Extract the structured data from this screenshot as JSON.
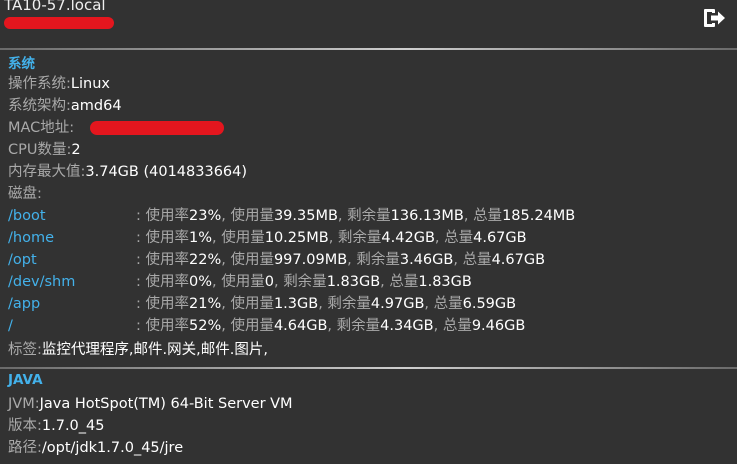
{
  "header": {
    "hostname": "TA10-57.local",
    "logout_icon": "logout-icon"
  },
  "system": {
    "title": "系统",
    "os_label": "操作系统:",
    "os_value": "Linux",
    "arch_label": "系统架构:",
    "arch_value": "amd64",
    "mac_label": "MAC地址:",
    "cpu_label": "CPU数量:",
    "cpu_value": "2",
    "mem_label": "内存最大值:",
    "mem_value": "3.74GB (4014833664)",
    "disk_label": "磁盘:",
    "tags_label": "标签:",
    "tags_value": "监控代理程序,邮件.网关,邮件.图片,"
  },
  "disks": [
    {
      "path": "/boot",
      "usage": "23%",
      "used": "39.35MB",
      "free": "136.13MB",
      "total": "185.24MB"
    },
    {
      "path": "/home",
      "usage": "1%",
      "used": "10.25MB",
      "free": "4.42GB",
      "total": "4.67GB"
    },
    {
      "path": "/opt",
      "usage": "22%",
      "used": "997.09MB",
      "free": "3.46GB",
      "total": "4.67GB"
    },
    {
      "path": "/dev/shm",
      "usage": "0%",
      "used": "0",
      "free": "1.83GB",
      "total": "1.83GB"
    },
    {
      "path": "/app",
      "usage": "21%",
      "used": "1.3GB",
      "free": "4.97GB",
      "total": "6.59GB"
    },
    {
      "path": "/",
      "usage": "52%",
      "used": "4.64GB",
      "free": "4.34GB",
      "total": "9.46GB"
    }
  ],
  "disk_labels": {
    "sep": ": ",
    "usage_label": "使用率",
    "used_label": "使用量",
    "free_label": "剩余量",
    "total_label": "总量",
    "comma": ", "
  },
  "java": {
    "title": "JAVA",
    "jvm_label": "JVM:",
    "jvm_value": "Java HotSpot(TM) 64-Bit Server VM",
    "version_label": "版本:",
    "version_value": "1.7.0_45",
    "path_label": "路径:",
    "path_value": "/opt/jdk1.7.0_45/jre"
  },
  "colors": {
    "background": "#323232",
    "accent": "#43b1ea",
    "label": "#a9a9a9",
    "redaction": "#e4161e"
  }
}
